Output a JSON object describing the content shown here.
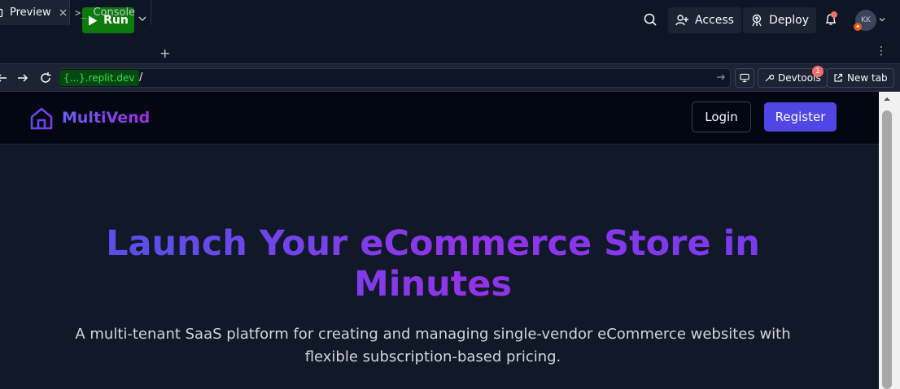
{
  "toolbar": {
    "run_label": "Run",
    "access_label": "Access",
    "deploy_label": "Deploy",
    "avatar_initials": "KK"
  },
  "tabs": {
    "preview_label": "Preview",
    "console_label": "Console",
    "add_label": "+",
    "more_label": "⋮"
  },
  "addressbar": {
    "domain": "{...}.replit.dev",
    "path": "/",
    "devtools_label": "Devtools",
    "devtools_badge": "1",
    "newtab_label": "New tab"
  },
  "site": {
    "brand": "MultiVend",
    "login_label": "Login",
    "register_label": "Register",
    "hero_title": "Launch Your eCommerce Store in Minutes",
    "hero_subtitle": "A multi-tenant SaaS platform for creating and managing single-vendor eCommerce websites with flexible subscription-based pricing."
  },
  "colors": {
    "accent": "#4f46e5",
    "run_green": "#0d7a0d",
    "brand_purple": "#7c3aed"
  }
}
